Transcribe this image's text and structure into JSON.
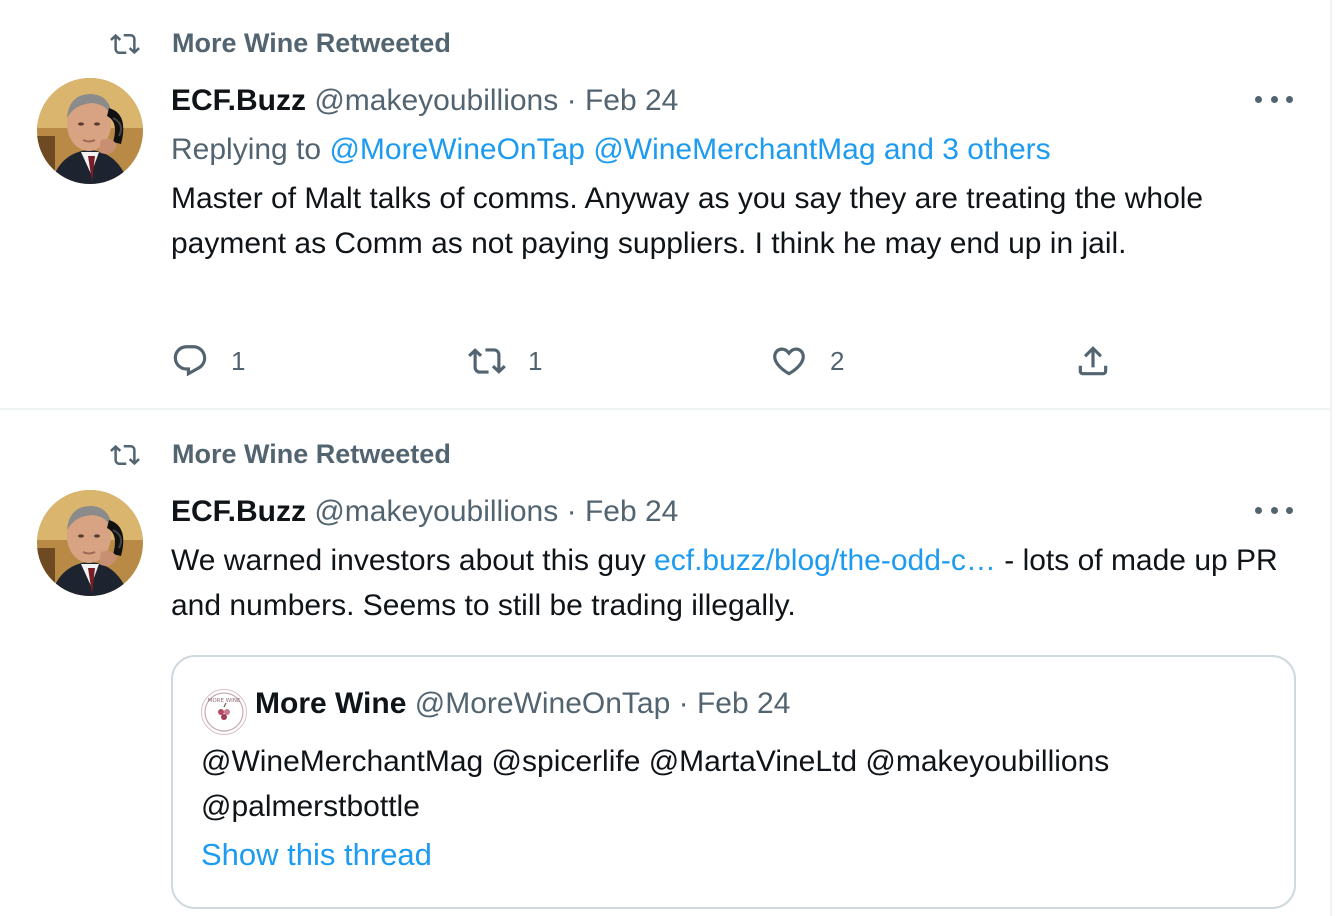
{
  "tweets": [
    {
      "retweet_label": "More Wine Retweeted",
      "author_name": "ECF.Buzz",
      "author_handle": "@makeyoubillions",
      "separator": "·",
      "date": "Feb 24",
      "replying_to_prefix": "Replying to",
      "replying_to_links": "@MoreWineOnTap @WineMerchantMag and 3 others",
      "text": "Master of Malt talks of comms. Anyway as you say they are treating the whole payment as Comm as not paying suppliers. I think he may end up in jail.",
      "actions": {
        "reply_count": "1",
        "retweet_count": "1",
        "like_count": "2"
      }
    },
    {
      "retweet_label": "More Wine Retweeted",
      "author_name": "ECF.Buzz",
      "author_handle": "@makeyoubillions",
      "separator": "·",
      "date": "Feb 24",
      "text_before_link": "We warned investors about this guy ",
      "link_text": "ecf.buzz/blog/the-odd-c…",
      "text_after_link": " - lots of made up PR and numbers. Seems to still be trading illegally.",
      "quote": {
        "author_name": "More Wine",
        "author_handle": "@MoreWineOnTap",
        "separator": "·",
        "date": "Feb 24",
        "text": "@WineMerchantMag @spicerlife @MartaVineLtd @makeyoubillions @palmerstbottle",
        "show_thread": "Show this thread",
        "avatar_logo_text": "MORE WINE"
      }
    }
  ],
  "icons": {
    "retweet": "retweet-icon",
    "reply": "reply-icon",
    "like": "heart-icon",
    "share": "share-icon",
    "more": "more-options-icon"
  },
  "colors": {
    "link": "#1d9bf0",
    "muted": "#536471",
    "text": "#0f1419",
    "border": "#cfd9de"
  }
}
